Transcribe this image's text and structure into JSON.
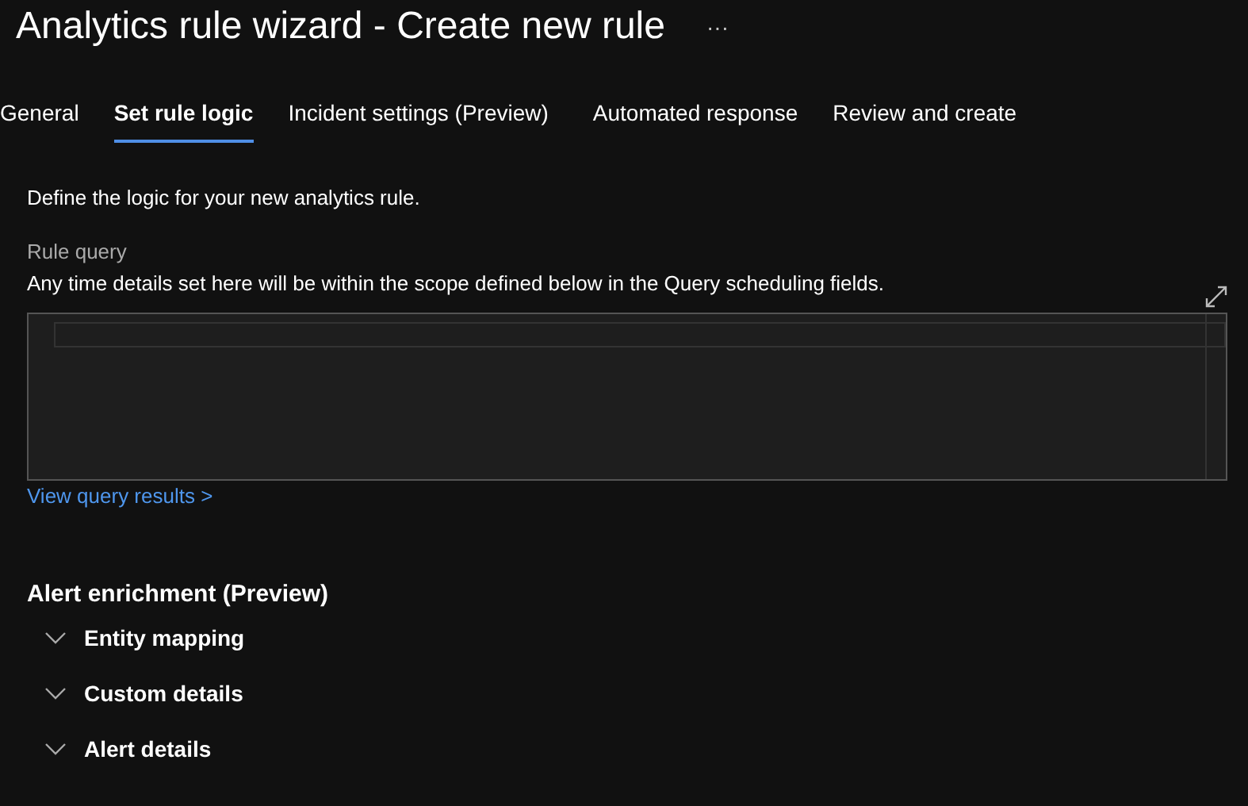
{
  "title": "Analytics rule wizard - Create new rule",
  "more": "···",
  "tabs": [
    {
      "label": "General",
      "selected": false
    },
    {
      "label": "Set rule logic",
      "selected": true
    },
    {
      "label": "Incident settings (Preview)",
      "selected": false
    },
    {
      "label": "Automated response",
      "selected": false
    },
    {
      "label": "Review and create",
      "selected": false
    }
  ],
  "intro": "Define the logic for your new analytics rule.",
  "rule_query": {
    "label": "Rule query",
    "description": "Any time details set here will be within the scope defined below in the Query scheduling fields."
  },
  "query_link": "View query results >",
  "enrichment": {
    "heading": "Alert enrichment (Preview)",
    "sections": [
      {
        "label": "Entity mapping",
        "expanded": false
      },
      {
        "label": "Custom details",
        "expanded": false
      },
      {
        "label": "Alert details",
        "expanded": false
      }
    ]
  }
}
